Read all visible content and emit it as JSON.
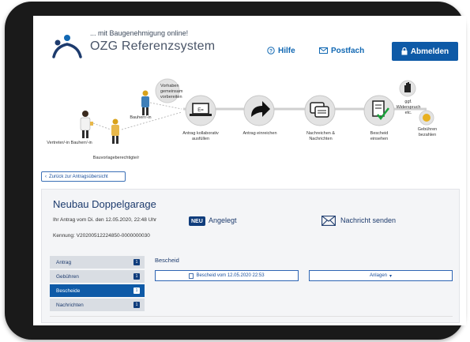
{
  "header": {
    "tagline": "... mit Baugenehmigung online!",
    "title": "OZG Referenzsystem",
    "hilfe_label": "Hilfe",
    "postfach_label": "Postfach",
    "abmelden_label": "Abmelden"
  },
  "process": {
    "vorhaben_note": "Vorhaben gemeinsam vorbereiten",
    "actor_left": "Vertreter/-in Bauherr/-in",
    "actor_bauherr": "Bauherr/-in",
    "actor_bauvorlage": "Bauvorlageberechtigte/r",
    "steps": [
      "Antrag kollaborativ ausfüllen",
      "Antrag einreichen",
      "Nachreichen & Nachrichten",
      "Bescheid einsehen"
    ],
    "widerspruch": "ggf. Widerspruch etc.",
    "gebuehren": "Gebühren bezahlen"
  },
  "back_link": "Zurück zur Antragsübersicht",
  "antrag": {
    "title": "Neubau Doppelgarage",
    "submitted": "Ihr Antrag vom Di. den 12.05.2020, 22:48 Uhr",
    "kennung": "Kennung: V20200512224850-0000000030",
    "badge": "NEU",
    "status": "Angelegt",
    "message_label": "Nachricht senden"
  },
  "nav": [
    {
      "label": "Antrag",
      "count": "1"
    },
    {
      "label": "Gebühren",
      "count": "1"
    },
    {
      "label": "Bescheide",
      "count": "1"
    },
    {
      "label": "Nachrichten",
      "count": "1"
    }
  ],
  "bescheid": {
    "heading": "Bescheid",
    "doc_button": "Bescheid vom 12.05.2020 22:53",
    "anlagen_button": "Anlagen"
  },
  "colors": {
    "primary": "#0e5aa7",
    "navy": "#103d7c",
    "panel": "#f4f5f7"
  }
}
